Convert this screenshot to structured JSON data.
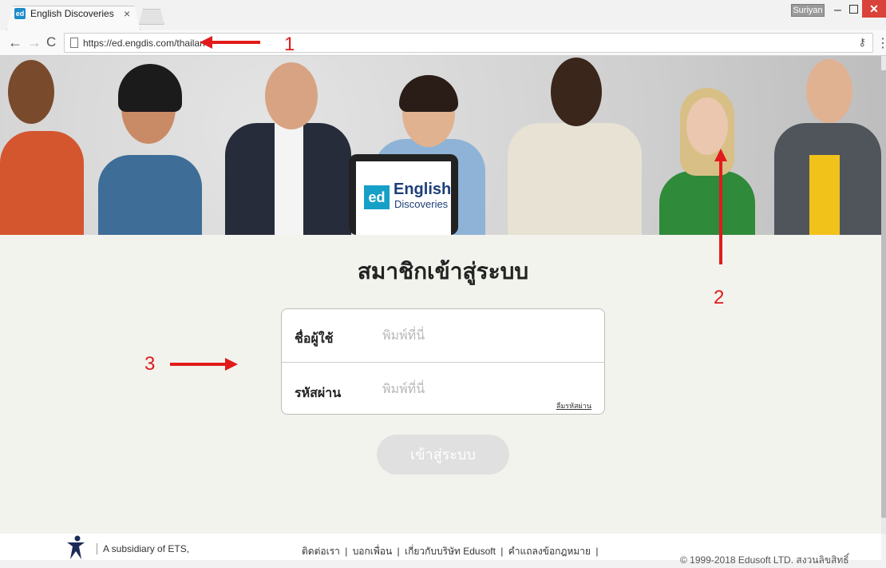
{
  "browser": {
    "tab_title": "English Discoveries",
    "tab_close": "×",
    "favicon_text": "ed",
    "user_name": "Suriyan",
    "url": "https://ed.engdis.com/thailan"
  },
  "hero": {
    "brand_mark": "ed",
    "brand_line1": "English",
    "brand_line2": "Discoveries"
  },
  "login": {
    "title": "สมาชิกเข้าสู่ระบบ",
    "username_label": "ชื่อผู้ใช้",
    "username_placeholder": "พิมพ์ที่นี่",
    "password_label": "รหัสผ่าน",
    "password_placeholder": "พิมพ์ที่นี่",
    "forgot_link": "ลืมรหัสผ่าน",
    "submit_label": "เข้าสู่ระบบ"
  },
  "footer": {
    "subsidiary": "A subsidiary of ETS,",
    "links": [
      "ติดต่อเรา",
      "บอกเพื่อน",
      "เกี่ยวกับบริษัท Edusoft",
      "คำแถลงข้อกฎหมาย"
    ],
    "separator": "|",
    "copyright": "© 1999-2018 Edusoft LTD. สงวนลิขสิทธิ์"
  },
  "annotations": {
    "label_1": "1",
    "label_2": "2",
    "label_3": "3",
    "color": "#e11b1b"
  },
  "colors": {
    "accent": "#16a0c7",
    "brand_text": "#1d3f78",
    "button_disabled": "#e0e0e0"
  }
}
